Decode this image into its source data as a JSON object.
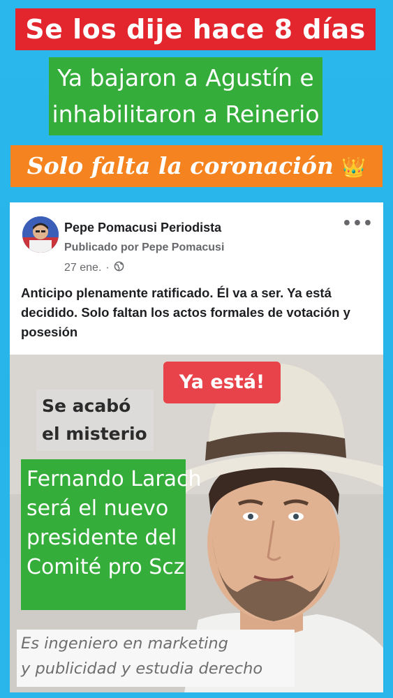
{
  "banners": {
    "top": "Se los dije hace 8 días",
    "middle_lines": [
      "Ya bajaron a Agustín e",
      "inhabilitaron a Reinerio"
    ],
    "orange": "Solo falta la coronación",
    "orange_emoji": "👑"
  },
  "post": {
    "page_name": "Pepe Pomacusi Periodista",
    "published_by": "Publicado por Pepe Pomacusi",
    "date": "27 ene.",
    "separator": "·",
    "more_icon": "•••",
    "text": "Anticipo plenamente ratificado. Él va a ser. Ya está decidido. Solo faltan los actos formales de votación y posesión"
  },
  "image_overlay": {
    "ya_esta": "Ya está!",
    "misterio_lines": [
      "Se acabó",
      "el misterio"
    ],
    "fernando_lines": [
      "Fernando Larach",
      "será el nuevo",
      "presidente del",
      "Comité pro Scz"
    ],
    "ingeniero_lines": [
      "Es ingeniero en marketing",
      "y publicidad y estudia derecho"
    ]
  },
  "colors": {
    "background": "#2ab8ec",
    "red_banner": "#e3262d",
    "green_banner": "#35ad3b",
    "orange_banner": "#f5831f",
    "ya_esta_badge": "#e8434b"
  }
}
